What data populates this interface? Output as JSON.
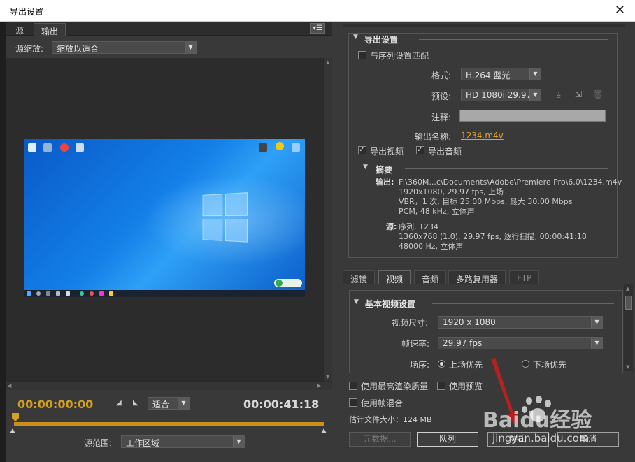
{
  "window": {
    "title": "导出设置",
    "close_glyph": "✕"
  },
  "left": {
    "tabs": [
      {
        "label": "源"
      },
      {
        "label": "输出"
      }
    ],
    "panel_menu_glyph": "▾☰",
    "source_scale": {
      "label": "源缩放:",
      "value": "缩放以适合"
    },
    "timecode_start": "00:00:00:00",
    "timecode_end": "00:00:41:18",
    "fit": {
      "value": "适合"
    },
    "source_range": {
      "label": "源范围:",
      "value": "工作区域"
    }
  },
  "export": {
    "title": "导出设置",
    "match_sequence": "与序列设置匹配",
    "format": {
      "label": "格式:",
      "value": "H.264 蓝光"
    },
    "preset": {
      "label": "预设:",
      "value": "HD 1080i 29.97"
    },
    "comment": {
      "label": "注释:",
      "value": ""
    },
    "output_name": {
      "label": "输出名称:",
      "value": "1234.m4v"
    },
    "export_video": "导出视频",
    "export_audio": "导出音频",
    "summary": {
      "title": "摘要",
      "output_label": "输出:",
      "output_lines": [
        "F:\\360M...c\\Documents\\Adobe\\Premiere Pro\\6.0\\1234.m4v",
        "1920x1080, 29.97 fps, 上场",
        "VBR，1 次, 目标 25.00 Mbps, 最大 30.00 Mbps",
        "PCM, 48 kHz, 立体声"
      ],
      "source_label": "源:",
      "source_lines": [
        "序列, 1234",
        "1360x768 (1.0), 29.97 fps, 逐行扫描, 00:00:41:18",
        "48000 Hz, 立体声"
      ]
    }
  },
  "settings_tabs": [
    {
      "label": "滤镜"
    },
    {
      "label": "视频"
    },
    {
      "label": "音频"
    },
    {
      "label": "多路复用器"
    },
    {
      "label": "FTP"
    }
  ],
  "video": {
    "title": "基本视频设置",
    "frame_size": {
      "label": "视频尺寸:",
      "value": "1920 x 1080"
    },
    "frame_rate": {
      "label": "帧速率:",
      "value": "29.97 fps"
    },
    "field_order": {
      "label": "场序:",
      "upper": "上场优先",
      "lower": "下场优先"
    }
  },
  "bottom": {
    "max_render_quality": "使用最高渲染质量",
    "use_previews": "使用预览",
    "frame_blending": "使用帧混合",
    "estimated_size": "估计文件大小：124 MB",
    "metadata_button": "元数据...",
    "queue_button": "队列",
    "export_button": "导出",
    "cancel_button": "取消"
  },
  "watermark": {
    "brand": "Baidu经验",
    "url": "jingyan.baidu.com"
  }
}
